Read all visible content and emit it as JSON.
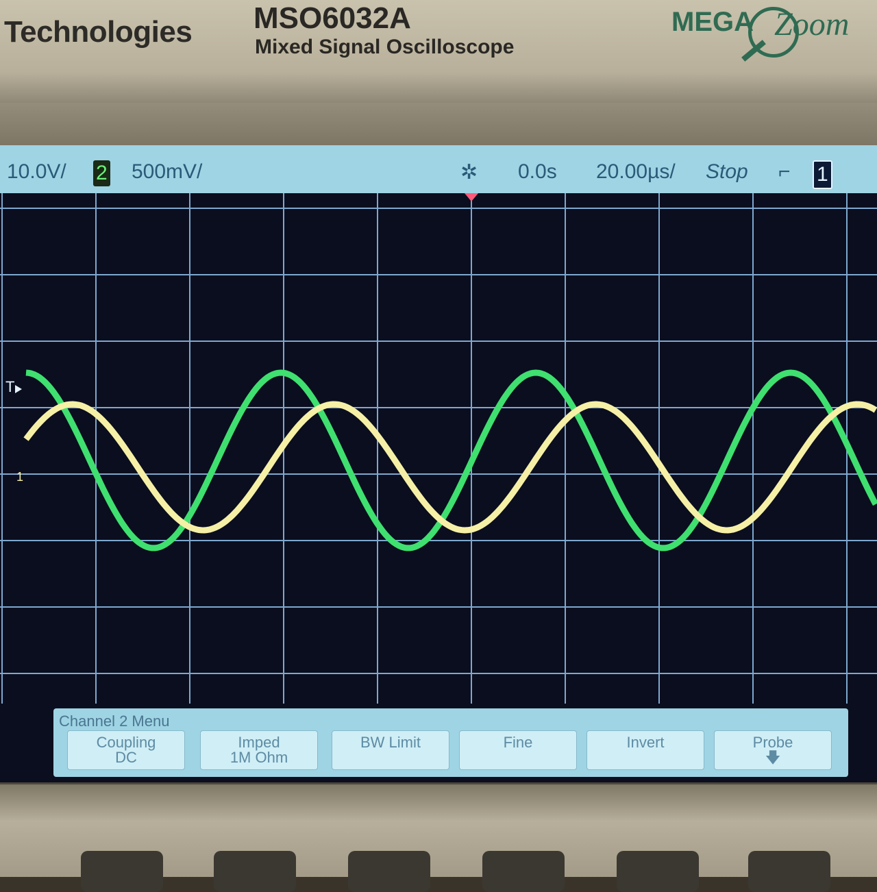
{
  "bezel": {
    "brand": "Technologies",
    "model": "MSO6032A",
    "description": "Mixed Signal Oscilloscope",
    "logo_mega": "MEGA",
    "logo_zoom": "Zoom"
  },
  "status": {
    "ch1_scale": "10.0V/",
    "ch2_number": "2",
    "ch2_scale": "500mV/",
    "delay": "0.0s",
    "timebase": "20.00µs/",
    "run_state": "Stop",
    "trigger_source": "1",
    "trigger_edge_icon": "rising-edge-icon",
    "acquire_icon": "sun-icon"
  },
  "markers": {
    "trigger_level": "T",
    "ch1_ground": "1"
  },
  "menu": {
    "title": "Channel 2 Menu",
    "softkeys": [
      {
        "label": "Coupling",
        "value": "DC"
      },
      {
        "label": "Imped",
        "value": "1M Ohm"
      },
      {
        "label": "BW Limit",
        "value": ""
      },
      {
        "label": "Fine",
        "value": ""
      },
      {
        "label": "Invert",
        "value": ""
      },
      {
        "label": "Probe",
        "value": ""
      }
    ]
  },
  "colors": {
    "ch1_trace": "#f6f0a6",
    "ch2_trace": "#3fe06f",
    "grid": "#7ea8cf",
    "screen_bg": "#0b0e1f",
    "status_bg": "#9fd4e4"
  }
}
